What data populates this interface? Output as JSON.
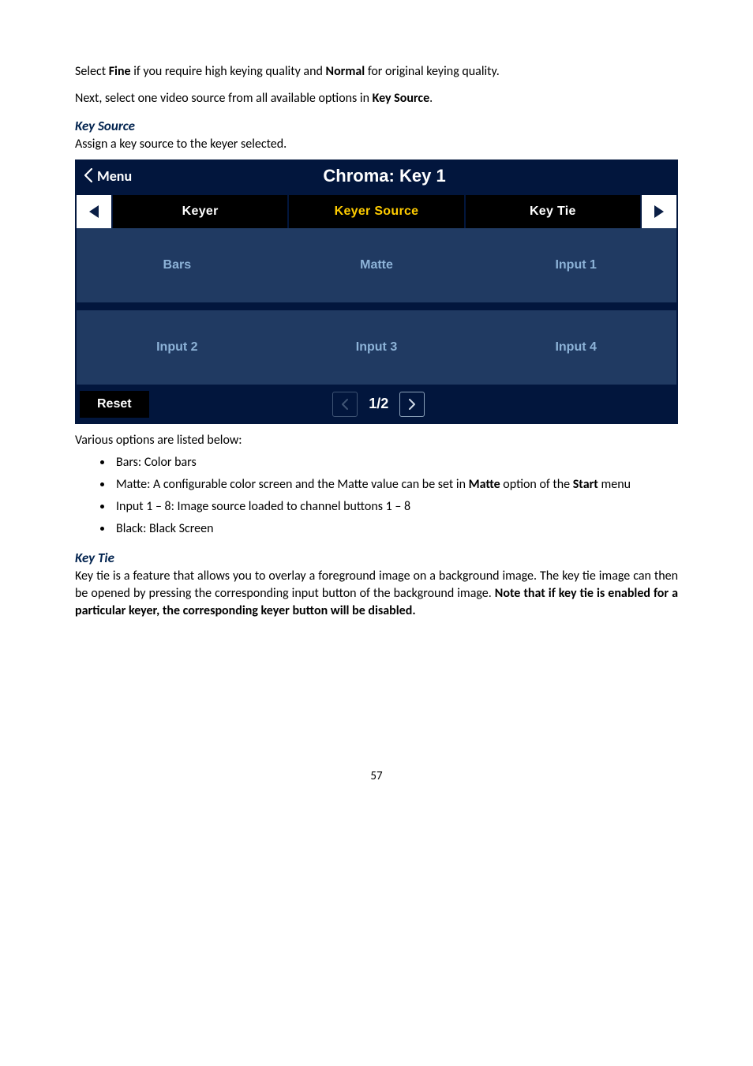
{
  "p1_a": "Select ",
  "p1_b": "Fine",
  "p1_c": " if you require high keying quality and ",
  "p1_d": "Normal",
  "p1_e": " for original keying quality.",
  "p2_a": "Next, select one video source from all available options in ",
  "p2_b": "Key Source",
  "p2_c": ".",
  "h_keysource": "Key Source",
  "p3": "Assign a key source to the keyer selected.",
  "menu": {
    "back_label": "Menu",
    "title": "Chroma: Key 1",
    "tabs": {
      "keyer": "Keyer",
      "source": "Keyer Source",
      "tie": "Key Tie"
    },
    "opts": [
      "Bars",
      "Matte",
      "Input 1",
      "Input 2",
      "Input 3",
      "Input 4"
    ],
    "reset": "Reset",
    "pager": "1/2"
  },
  "p4": "Various options are listed below:",
  "b1": "Bars: Color bars",
  "b2_a": "Matte: A configurable color screen and the Matte value can be set in ",
  "b2_b": "Matte",
  "b2_c": " option of the ",
  "b2_d": "Start",
  "b2_e": " menu",
  "b3": "Input 1 – 8: Image source loaded to channel buttons 1 – 8",
  "b4": "Black: Black Screen",
  "h_keytie": "Key Tie",
  "p5_a": "Key tie is a feature that allows you to overlay a foreground image on a background image. The key tie image can then be opened by pressing the corresponding input button of the background image. ",
  "p5_b": "Note that if key tie is enabled for a particular keyer, the corresponding keyer button will be disabled.",
  "pagenum": "57"
}
